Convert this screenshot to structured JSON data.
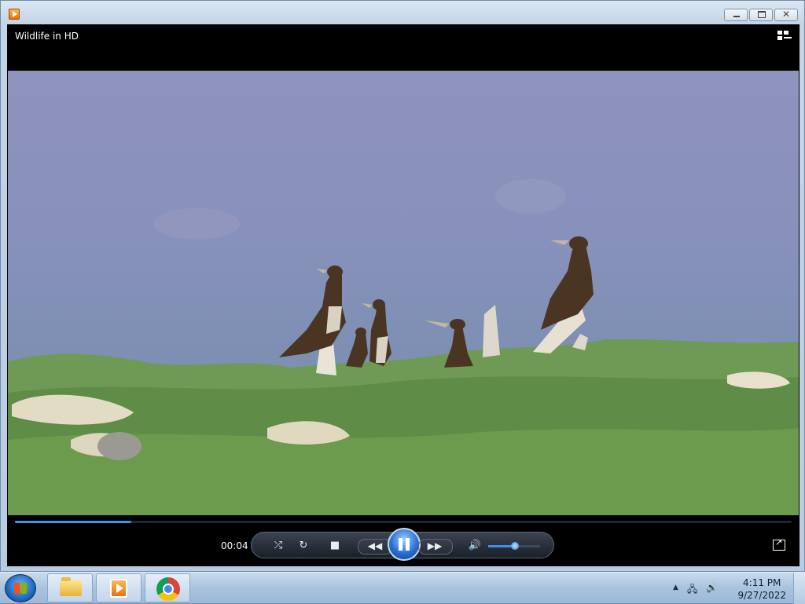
{
  "window": {
    "title": "Wildlife in HD"
  },
  "caption_buttons": {
    "minimize": "",
    "maximize": "",
    "close": "✕"
  },
  "player": {
    "elapsed": "00:04",
    "progress": 0.15,
    "volume": 0.51,
    "accent_color": "#4f8ee0"
  },
  "controls": {
    "shuffle_icon": "shuffle-icon",
    "repeat_icon": "repeat-icon",
    "stop_icon": "stop-icon",
    "previous_icon": "previous-icon",
    "pause_icon": "pause-icon",
    "next_icon": "next-icon",
    "mute_icon": "speaker-icon"
  },
  "taskbar": {
    "items": [
      "windows-explorer",
      "windows-media-player",
      "google-chrome"
    ],
    "tray": {
      "time": "4:11 PM",
      "date": "9/27/2022"
    }
  }
}
